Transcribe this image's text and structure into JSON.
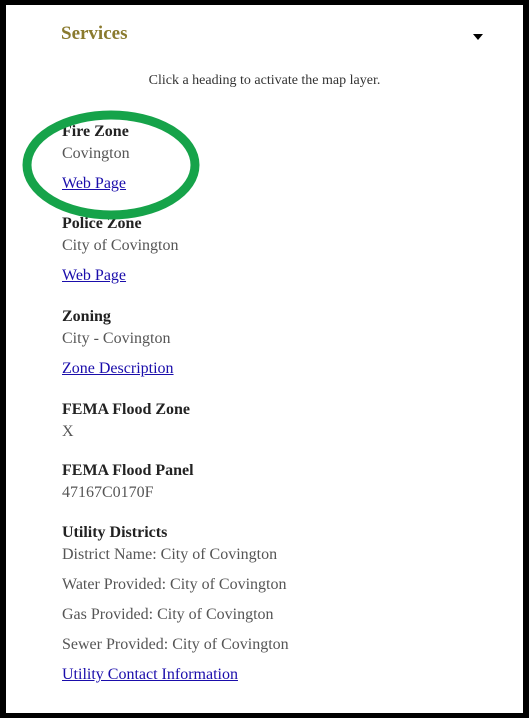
{
  "header": {
    "title": "Services"
  },
  "instruction": "Click a heading to activate the map layer.",
  "fire_zone": {
    "heading": "Fire Zone",
    "value": "Covington",
    "link": "Web Page"
  },
  "police_zone": {
    "heading": "Police Zone",
    "value": "City of Covington",
    "link": "Web Page"
  },
  "zoning": {
    "heading": "Zoning",
    "value": "City - Covington",
    "link": "Zone Description"
  },
  "flood_zone": {
    "heading": "FEMA Flood Zone",
    "value": "X"
  },
  "flood_panel": {
    "heading": "FEMA Flood Panel",
    "value": "47167C0170F"
  },
  "utility": {
    "heading": "Utility Districts",
    "district": "District Name: City of Covington",
    "water": "Water Provided: City of Covington",
    "gas": "Gas Provided: City of Covington",
    "sewer": "Sewer Provided: City of Covington",
    "link": "Utility Contact Information"
  },
  "colors": {
    "heading": "#8a7a2e",
    "link": "#1a0dab",
    "highlight": "#16a34a"
  }
}
